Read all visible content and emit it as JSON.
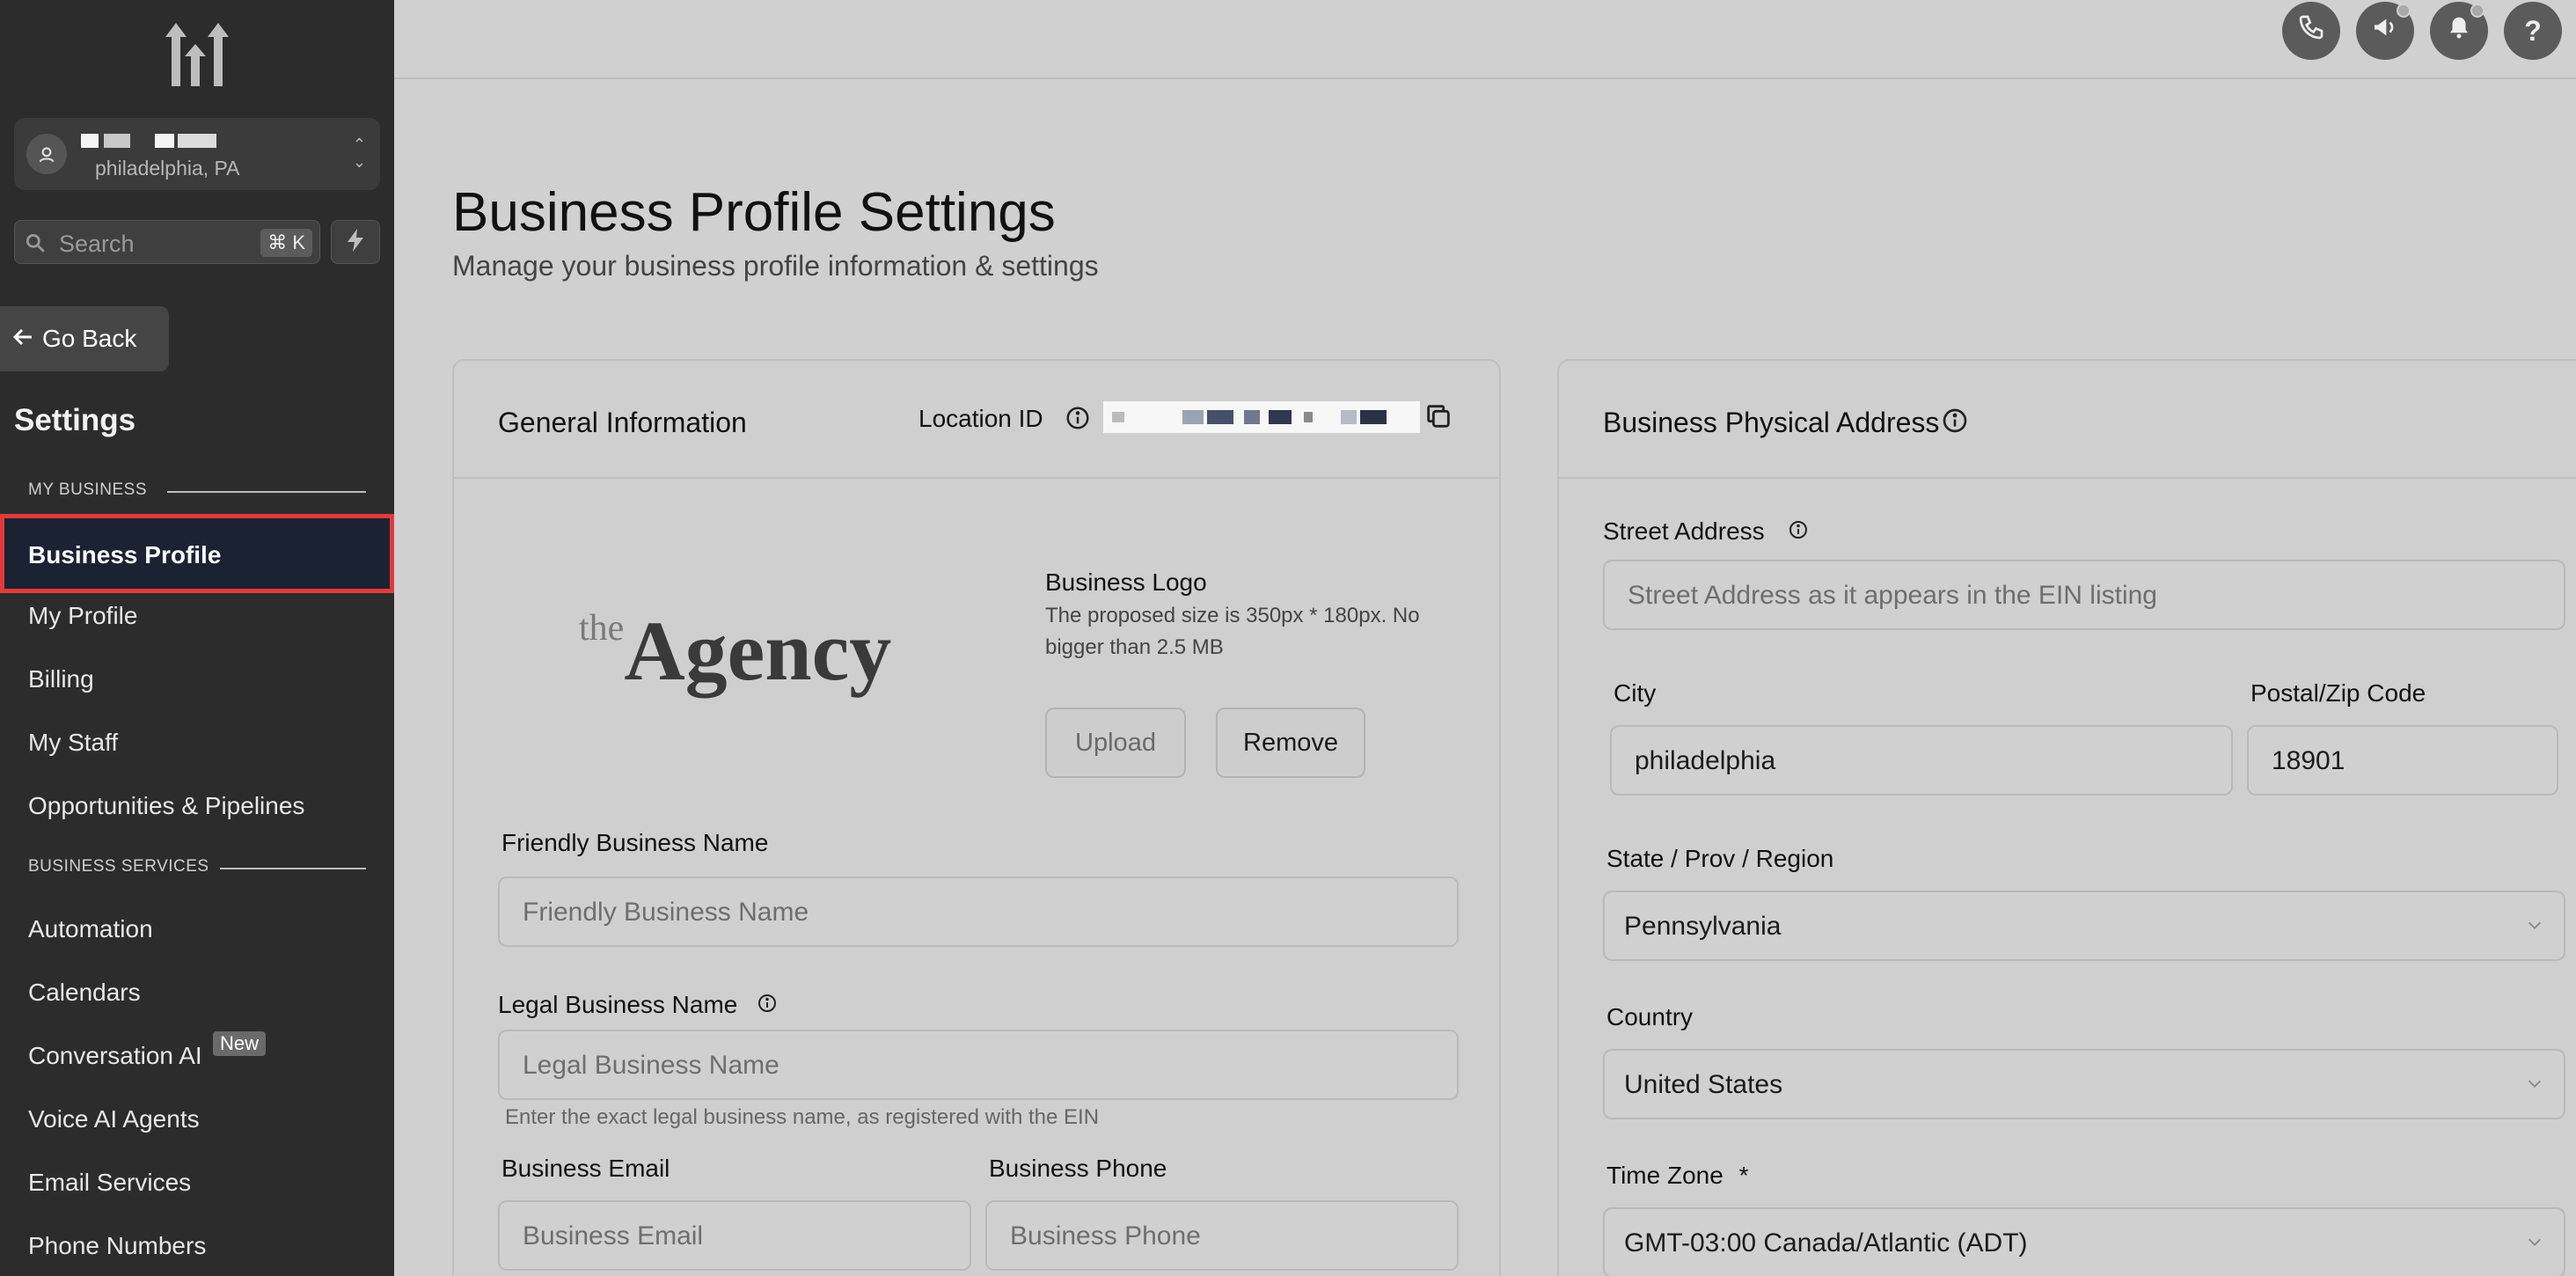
{
  "sidebar": {
    "account": {
      "location": "philadelphia, PA"
    },
    "search": {
      "placeholder": "Search",
      "shortcut": "⌘ K"
    },
    "go_back": "Go Back",
    "settings_title": "Settings",
    "sections": [
      {
        "label": "MY BUSINESS",
        "items": [
          "Business Profile",
          "My Profile",
          "Billing",
          "My Staff",
          "Opportunities & Pipelines"
        ]
      },
      {
        "label": "BUSINESS SERVICES",
        "items": [
          "Automation",
          "Calendars",
          "Conversation AI",
          "Voice AI Agents",
          "Email Services",
          "Phone Numbers"
        ]
      }
    ],
    "active_item": "Business Profile",
    "new_badge": "New"
  },
  "topbar": {
    "icons": [
      "phone-icon",
      "megaphone-icon",
      "bell-icon",
      "help-icon"
    ],
    "help_label": "?"
  },
  "page": {
    "title": "Business Profile Settings",
    "subtitle": "Manage your business profile information & settings"
  },
  "general": {
    "title": "General Information",
    "location_id_label": "Location ID",
    "logo_prefix": "the",
    "logo_word": "Agency",
    "logo_title": "Business Logo",
    "logo_hint_1": "The proposed size is 350px * 180px. No",
    "logo_hint_2": "bigger than 2.5 MB",
    "upload": "Upload",
    "remove": "Remove",
    "friendly_label": "Friendly Business Name",
    "friendly_placeholder": "Friendly Business Name",
    "legal_label": "Legal Business Name",
    "legal_placeholder": "Legal Business Name",
    "legal_hint": "Enter the exact legal business name, as registered with the EIN",
    "email_label": "Business Email",
    "email_placeholder": "Business Email",
    "phone_label": "Business Phone",
    "phone_placeholder": "Business Phone"
  },
  "address": {
    "title": "Business Physical Address",
    "street_label": "Street Address",
    "street_placeholder": "Street Address as it appears in the EIN listing",
    "city_label": "City",
    "city_value": "philadelphia",
    "zip_label": "Postal/Zip Code",
    "zip_value": "18901",
    "state_label": "State / Prov / Region",
    "state_value": "Pennsylvania",
    "country_label": "Country",
    "country_value": "United States",
    "timezone_label": "Time Zone",
    "timezone_required": "*",
    "timezone_value": "GMT-03:00 Canada/Atlantic (ADT)"
  },
  "colors": {
    "sidebar_bg": "#2c2c2c",
    "active_bg": "#1b2233",
    "highlight_border": "#e23b3b"
  }
}
